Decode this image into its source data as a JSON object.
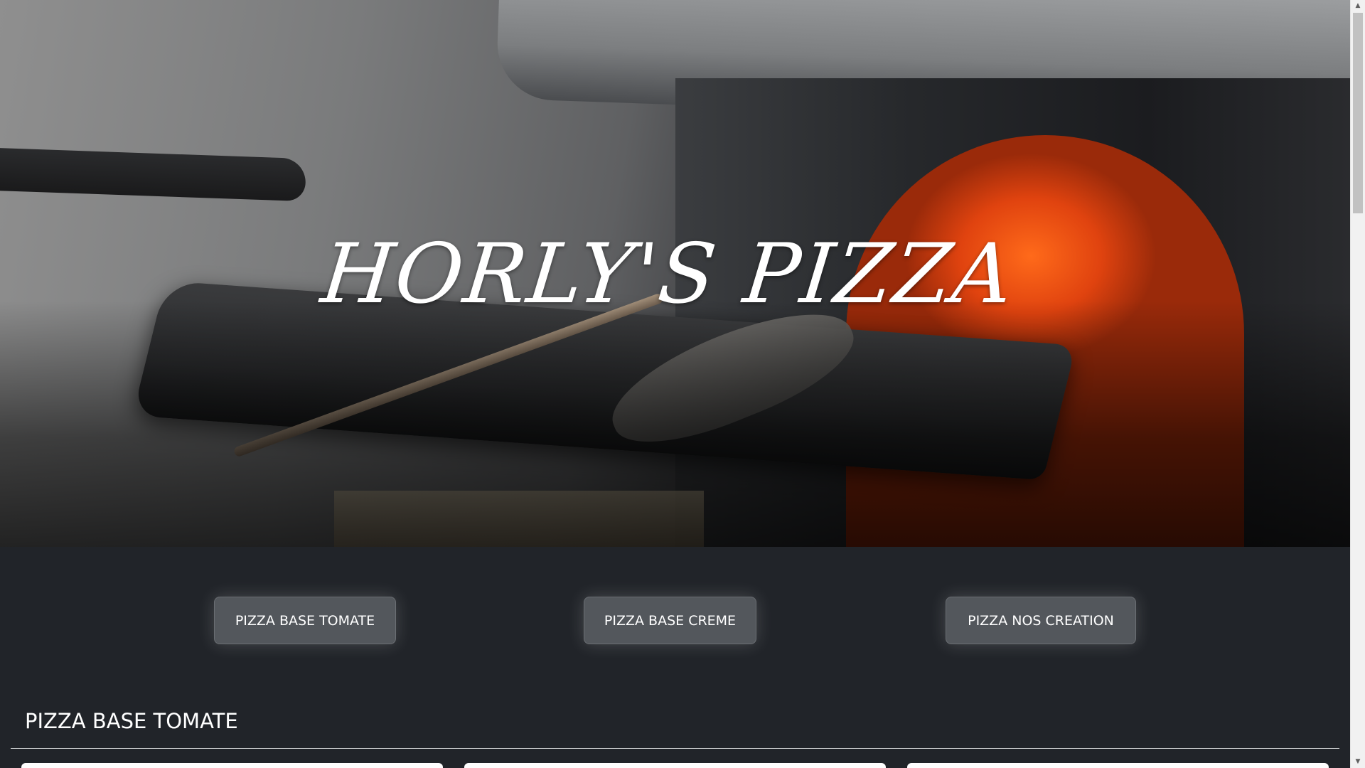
{
  "hero": {
    "title": "HORLY'S PIZZA"
  },
  "categories": [
    {
      "label": "PIZZA BASE TOMATE"
    },
    {
      "label": "PIZZA BASE CREME"
    },
    {
      "label": "PIZZA NOS CREATION"
    }
  ],
  "section": {
    "title": "PIZZA BASE TOMATE"
  },
  "scrollbar": {
    "up_arrow": "▲",
    "down_arrow": "▼"
  },
  "colors": {
    "page_background": "#212429",
    "button_background": "#53575c",
    "text": "#ffffff"
  }
}
